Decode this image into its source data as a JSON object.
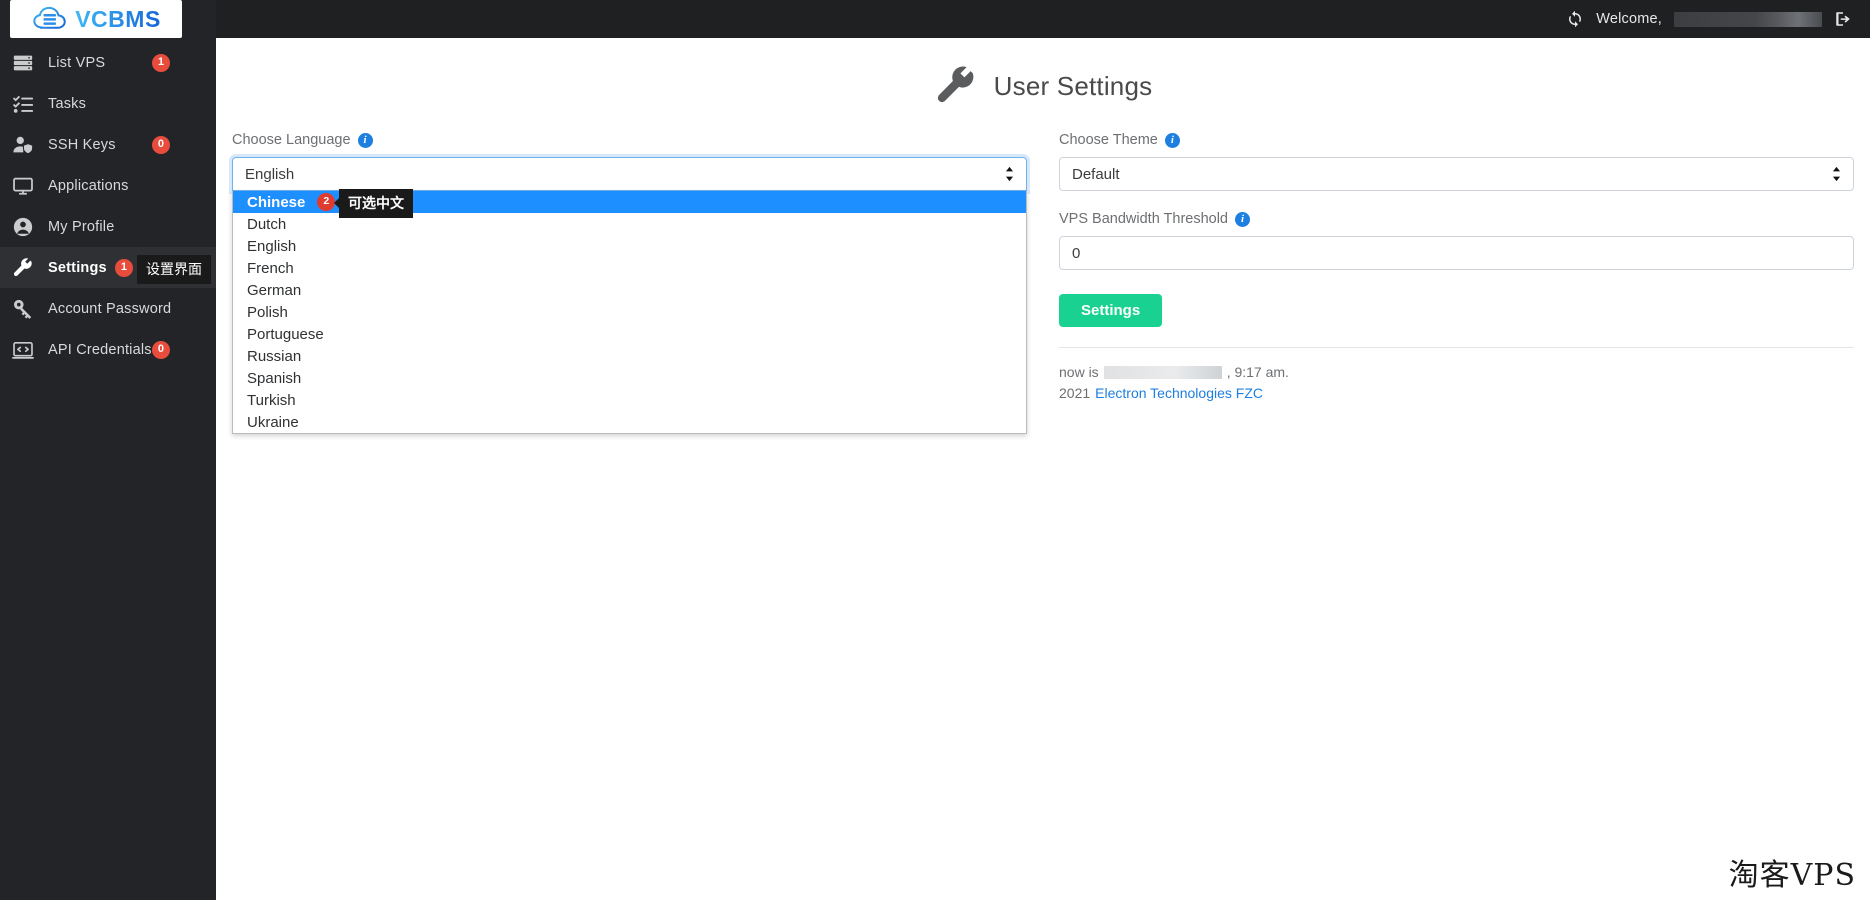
{
  "brand": {
    "logo_text": "VCBMS",
    "logo_icon": "cloud-server-icon",
    "accent_blue": "#1d7fe0",
    "accent_green": "#19d291",
    "badge_red": "#e74c3c"
  },
  "topbar": {
    "sync_icon": "sync-icon",
    "welcome_label": "Welcome,",
    "username_redacted": "",
    "logout_icon": "logout-icon"
  },
  "sidebar": {
    "items": [
      {
        "label": "List VPS",
        "icon": "server-stack-icon",
        "badge": "1",
        "active": false
      },
      {
        "label": "Tasks",
        "icon": "task-list-icon",
        "badge": null,
        "active": false
      },
      {
        "label": "SSH Keys",
        "icon": "user-shield-icon",
        "badge": "0",
        "active": false
      },
      {
        "label": "Applications",
        "icon": "monitor-icon",
        "badge": null,
        "active": false
      },
      {
        "label": "My Profile",
        "icon": "user-circle-icon",
        "badge": null,
        "active": false
      },
      {
        "label": "Settings",
        "icon": "wrench-icon",
        "badge": "1",
        "active": true
      },
      {
        "label": "Account Password",
        "icon": "key-icon",
        "badge": null,
        "active": false
      },
      {
        "label": "API Credentials",
        "icon": "code-window-icon",
        "badge": "0",
        "active": false
      }
    ],
    "tooltip": "设置界面"
  },
  "page": {
    "title": "User Settings",
    "title_icon": "wrench-icon"
  },
  "language_field": {
    "label": "Choose Language",
    "info_icon": "info-icon",
    "value": "English",
    "open": true,
    "options": [
      {
        "label": "Chinese",
        "selected": true,
        "badge": "2",
        "tooltip": "可选中文"
      },
      {
        "label": "Dutch",
        "selected": false,
        "badge": null,
        "tooltip": null
      },
      {
        "label": "English",
        "selected": false,
        "badge": null,
        "tooltip": null
      },
      {
        "label": "French",
        "selected": false,
        "badge": null,
        "tooltip": null
      },
      {
        "label": "German",
        "selected": false,
        "badge": null,
        "tooltip": null
      },
      {
        "label": "Polish",
        "selected": false,
        "badge": null,
        "tooltip": null
      },
      {
        "label": "Portuguese",
        "selected": false,
        "badge": null,
        "tooltip": null
      },
      {
        "label": "Russian",
        "selected": false,
        "badge": null,
        "tooltip": null
      },
      {
        "label": "Spanish",
        "selected": false,
        "badge": null,
        "tooltip": null
      },
      {
        "label": "Turkish",
        "selected": false,
        "badge": null,
        "tooltip": null
      },
      {
        "label": "Ukraine",
        "selected": false,
        "badge": null,
        "tooltip": null
      }
    ]
  },
  "theme_field": {
    "label": "Choose Theme",
    "info_icon": "info-icon",
    "value": "Default"
  },
  "bandwidth_field": {
    "label": "VPS Bandwidth Threshold",
    "info_icon": "info-icon",
    "value": "0"
  },
  "submit_button": {
    "label": "Settings"
  },
  "footer": {
    "time_prefix": "now is",
    "time_redacted": "",
    "time_suffix": ", 9:17 am.",
    "copyright_year": "2021",
    "company_link": "Electron Technologies FZC"
  },
  "watermark": {
    "text": "淘客VPS"
  }
}
